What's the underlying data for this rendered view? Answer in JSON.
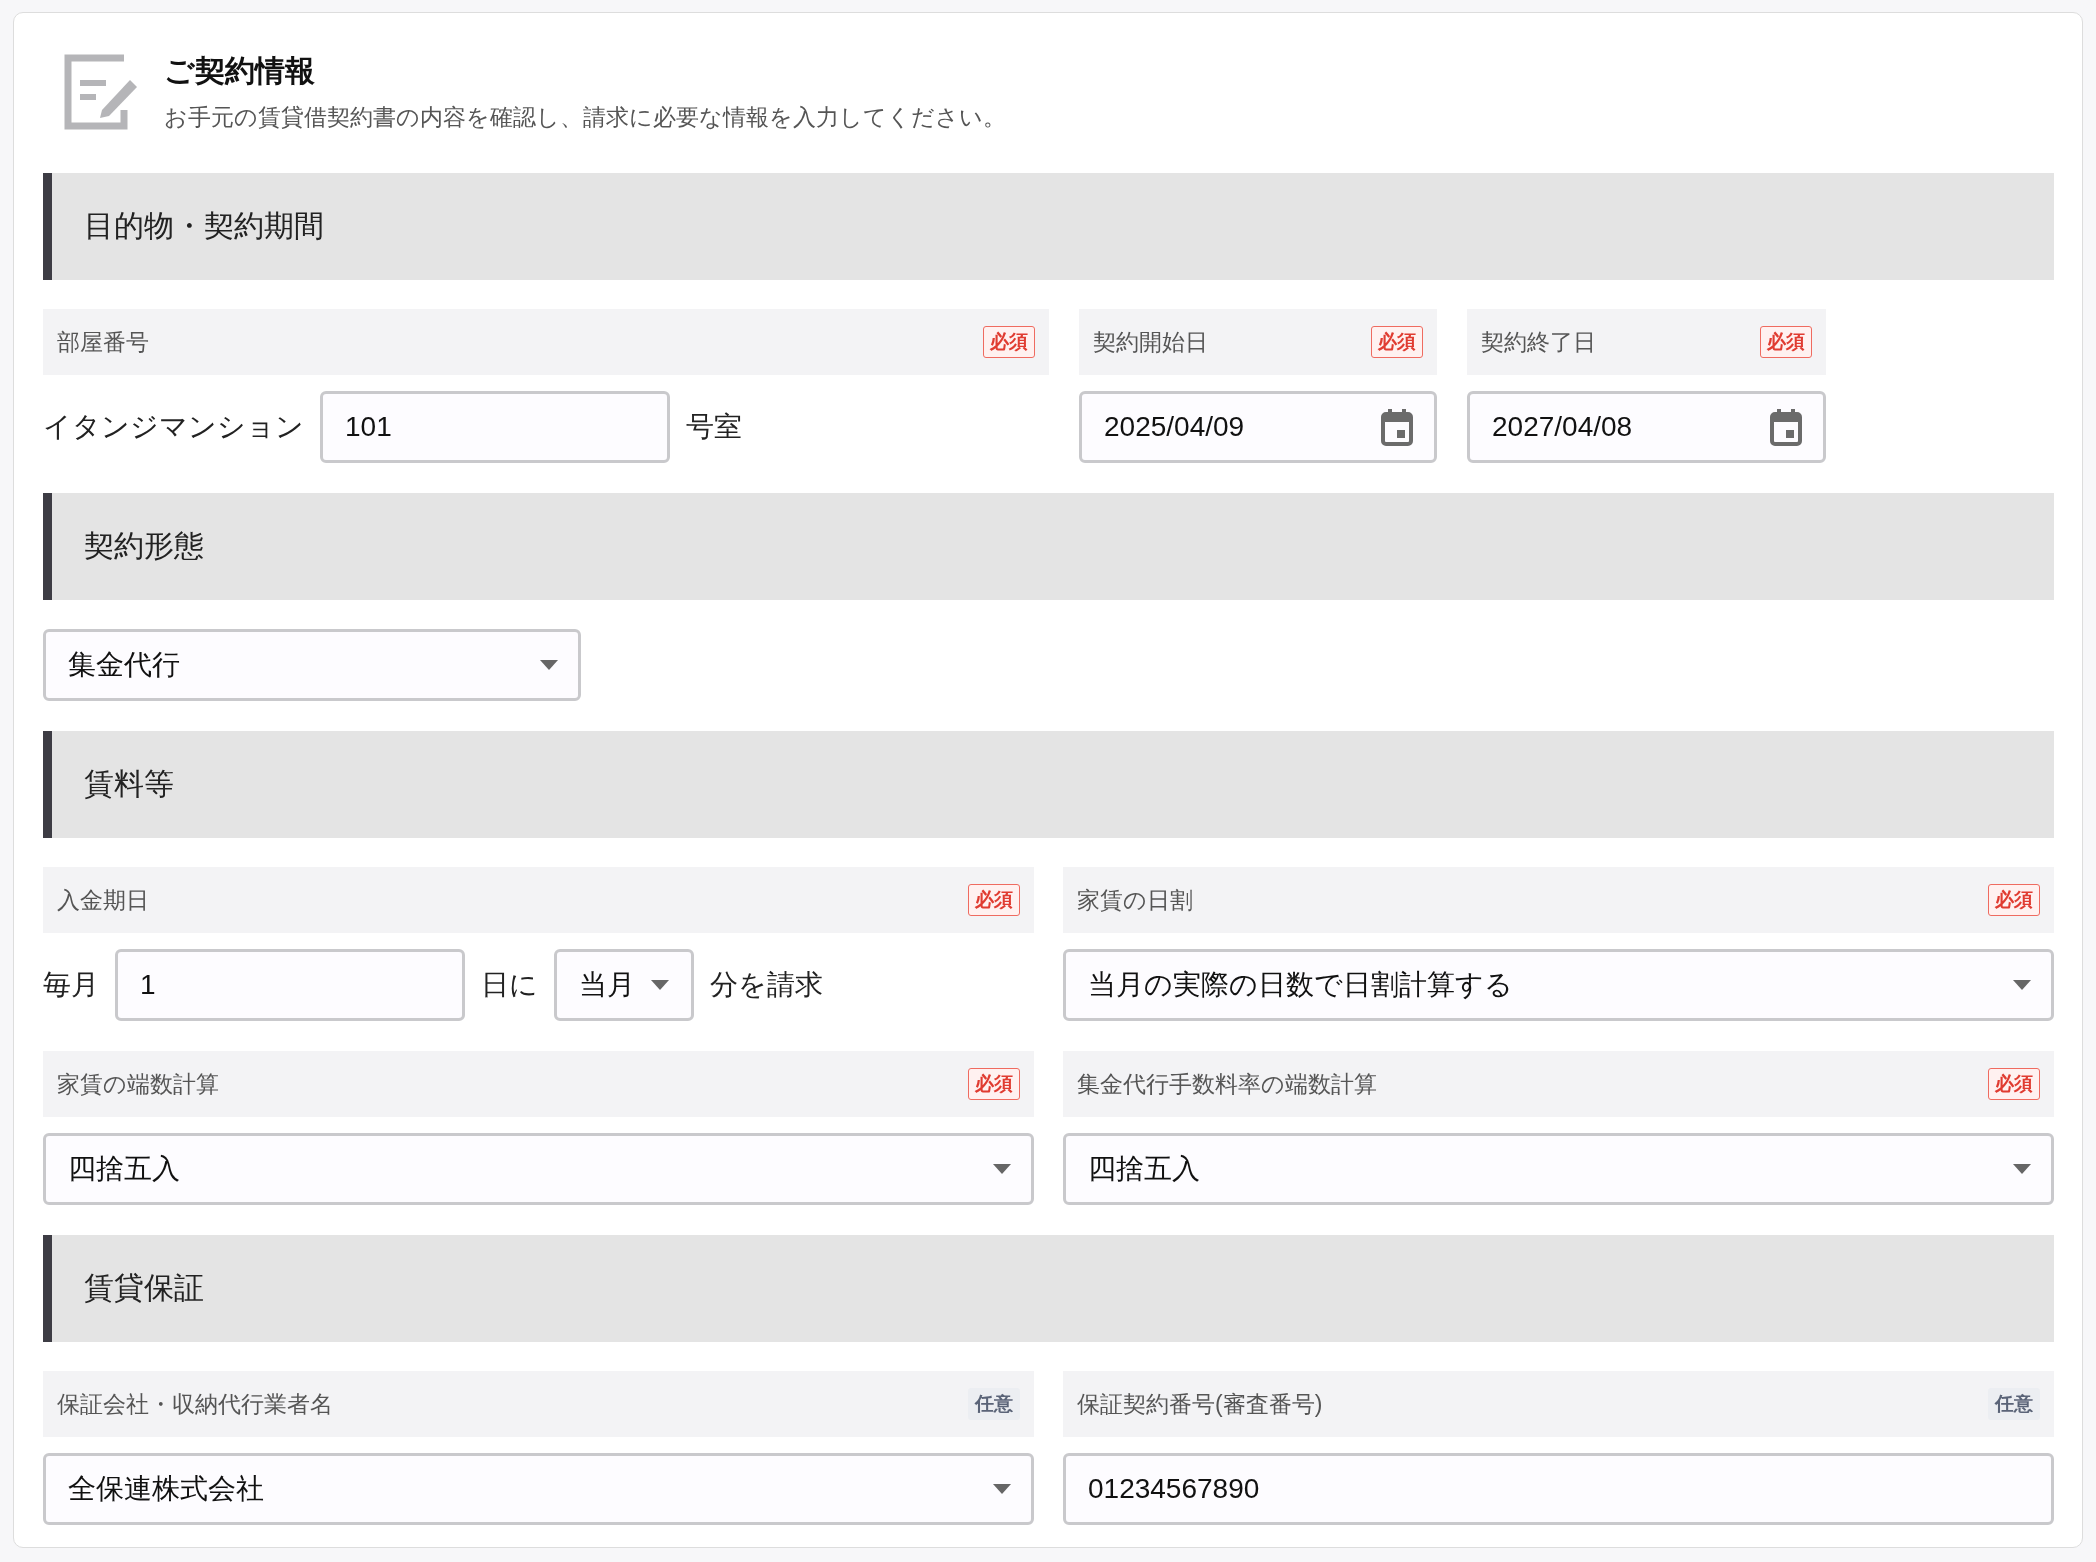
{
  "header": {
    "title": "ご契約情報",
    "description": "お手元の賃貸借契約書の内容を確認し、請求に必要な情報を入力してください。"
  },
  "sections": [
    {
      "title": "目的物・契約期間",
      "fields": [
        {
          "kind": "room",
          "label": "部屋番号",
          "badge": {
            "text": "必須",
            "kind": "required"
          },
          "prefix": "イタンジマンション",
          "value": "101",
          "suffix": "号室"
        },
        {
          "kind": "date",
          "label": "契約開始日",
          "badge": {
            "text": "必須",
            "kind": "required"
          },
          "value": "2025/04/09"
        },
        {
          "kind": "date",
          "label": "契約終了日",
          "badge": {
            "text": "必須",
            "kind": "required"
          },
          "value": "2027/04/08"
        }
      ]
    },
    {
      "title": "契約形態",
      "fields": [
        {
          "kind": "select",
          "value": "集金代行"
        }
      ]
    },
    {
      "title": "賃料等",
      "fields": [
        {
          "kind": "due",
          "label": "入金期日",
          "badge": {
            "text": "必須",
            "kind": "required"
          },
          "prefix": "毎月",
          "value": "1",
          "middle": "日に",
          "option": "当月",
          "suffix": "分を請求"
        },
        {
          "kind": "select",
          "label": "家賃の日割",
          "badge": {
            "text": "必須",
            "kind": "required"
          },
          "value": "当月の実際の日数で日割計算する"
        },
        {
          "kind": "select",
          "label": "家賃の端数計算",
          "badge": {
            "text": "必須",
            "kind": "required"
          },
          "value": "四捨五入"
        },
        {
          "kind": "select",
          "label": "集金代行手数料率の端数計算",
          "badge": {
            "text": "必須",
            "kind": "required"
          },
          "value": "四捨五入"
        }
      ]
    },
    {
      "title": "賃貸保証",
      "fields": [
        {
          "kind": "select",
          "label": "保証会社・収納代行業者名",
          "badge": {
            "text": "任意",
            "kind": "optional"
          },
          "value": "全保連株式会社"
        },
        {
          "kind": "text",
          "label": "保証契約番号(審査番号)",
          "badge": {
            "text": "任意",
            "kind": "optional"
          },
          "value": "01234567890"
        }
      ]
    }
  ]
}
